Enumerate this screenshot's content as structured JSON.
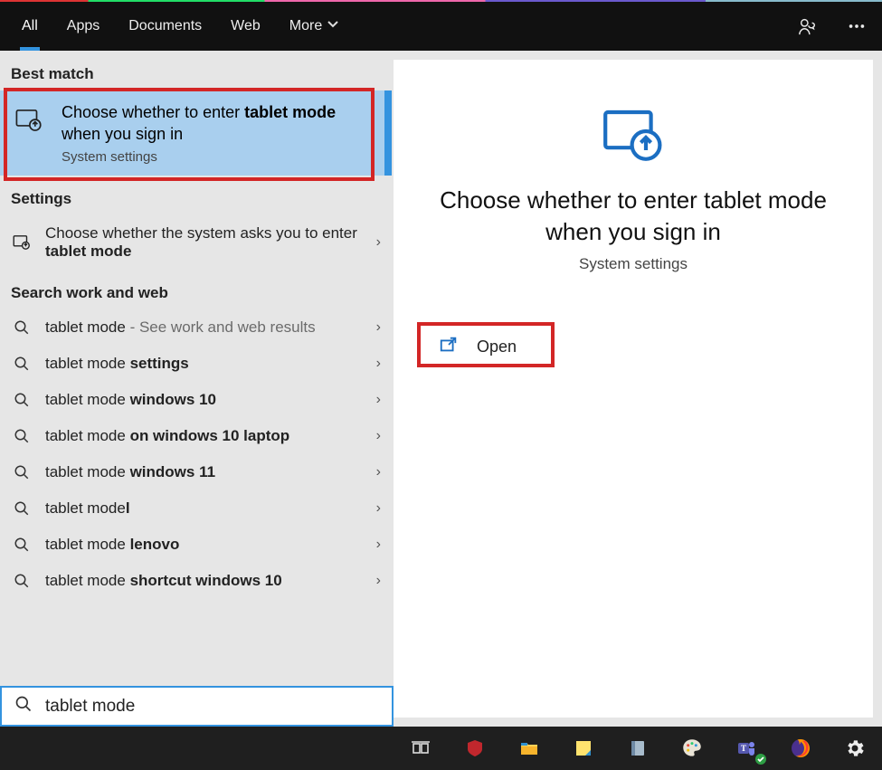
{
  "tabs": {
    "all": "All",
    "apps": "Apps",
    "documents": "Documents",
    "web": "Web",
    "more": "More"
  },
  "sections": {
    "best_match": "Best match",
    "settings": "Settings",
    "search_work_web": "Search work and web"
  },
  "best_match_item": {
    "title_prefix": "Choose whether to enter ",
    "title_bold": "tablet mode",
    "title_suffix": " when you sign in",
    "subtitle": "System settings"
  },
  "settings_item": {
    "prefix": "Choose whether the system asks you to enter ",
    "bold": "tablet mode"
  },
  "web_results": [
    {
      "prefix": "tablet mode",
      "suffix": "",
      "hint": " - See work and web results"
    },
    {
      "prefix": "tablet mode ",
      "suffix": "settings",
      "hint": ""
    },
    {
      "prefix": "tablet mode ",
      "suffix": "windows 10",
      "hint": ""
    },
    {
      "prefix": "tablet mode ",
      "suffix": "on windows 10 laptop",
      "hint": ""
    },
    {
      "prefix": "tablet mode ",
      "suffix": "windows 11",
      "hint": ""
    },
    {
      "prefix": "tablet mode",
      "suffix": "l",
      "hint": ""
    },
    {
      "prefix": "tablet mode ",
      "suffix": "lenovo",
      "hint": ""
    },
    {
      "prefix": "tablet mode ",
      "suffix": "shortcut windows 10",
      "hint": ""
    }
  ],
  "preview": {
    "title": "Choose whether to enter tablet mode when you sign in",
    "subtitle": "System settings",
    "open": "Open"
  },
  "search": {
    "value": "tablet mode"
  },
  "taskbar": {
    "icons": [
      "task-view",
      "mcafee",
      "file-explorer",
      "sticky-notes",
      "journal",
      "paint",
      "teams",
      "firefox",
      "settings"
    ]
  }
}
